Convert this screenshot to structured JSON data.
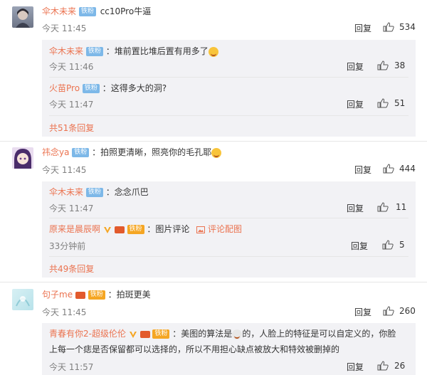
{
  "comments": [
    {
      "user": "伞木未来",
      "badge": "铁粉",
      "text": "cc10Pro牛逼",
      "time": "今天 11:45",
      "reply_label": "回复",
      "likes": "534",
      "replies": [
        {
          "user": "伞木未来",
          "badge": "铁粉",
          "text": "：堆前置比堆后置有用多了",
          "time": "今天 11:46",
          "reply_label": "回复",
          "likes": "38"
        },
        {
          "user": "火苗Pro",
          "badge": "铁粉",
          "text": "：这得多大的洞?",
          "time": "今天 11:47",
          "reply_label": "回复",
          "likes": "51"
        }
      ],
      "more": "共51条回复"
    },
    {
      "user": "祎念ya",
      "badge": "铁粉",
      "text": "：拍照更清晰，照亮你的毛孔耶",
      "time": "今天 11:45",
      "reply_label": "回复",
      "likes": "444",
      "replies": [
        {
          "user": "伞木未来",
          "badge": "铁粉",
          "text": "：念念爪巴",
          "time": "今天 11:47",
          "reply_label": "回复",
          "likes": "11"
        },
        {
          "user": "原来是晨辰啊",
          "badge": "铁粉",
          "text": "：图片评论",
          "link": "评论配图",
          "time": "33分钟前",
          "reply_label": "回复",
          "likes": "5"
        }
      ],
      "more": "共49条回复"
    },
    {
      "user": "句子me",
      "badge": "铁粉",
      "text": "：拍斑更美",
      "time": "今天 11:45",
      "reply_label": "回复",
      "likes": "260",
      "replies": [
        {
          "user": "青春有你2-超级伦伦",
          "badge": "铁粉",
          "text": "：美图的算法是",
          "text_after": "的，人脸上的特征是可以自定义的，你脸",
          "text_line2": "上每一个痣是否保留都可以选择的，所以不用担心缺点被放大和特效被删掉的",
          "time": "今天 11:57",
          "reply_label": "回复",
          "likes": "26"
        }
      ]
    }
  ],
  "colors": {
    "username": "#eb7350",
    "badge": "#7db8e8",
    "reply_bg": "#f2f2f5"
  }
}
